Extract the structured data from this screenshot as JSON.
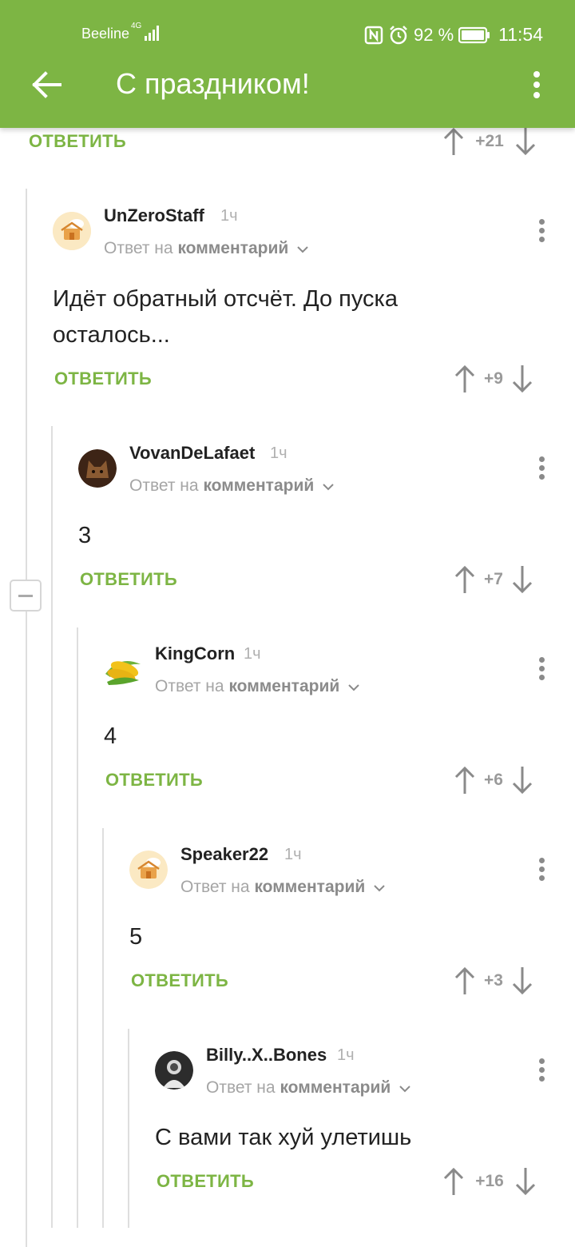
{
  "status_bar": {
    "carrier": "Beeline",
    "network": "4G",
    "battery": "92 %",
    "time": "11:54"
  },
  "header": {
    "title": "С праздником!",
    "back_icon": "arrow-left-icon",
    "menu_icon": "kebab-menu-icon"
  },
  "top_action": {
    "reply_label": "ОТВЕТИТЬ",
    "score": "+21"
  },
  "comments": [
    {
      "author": "UnZeroStaff",
      "age": "1ч",
      "reply_prefix": "Ответ на",
      "reply_link": "комментарий",
      "text_line1": "Идёт обратный отсчёт. До пуска",
      "text_line2": "осталось...",
      "reply_label": "ОТВЕТИТЬ",
      "score": "+9"
    },
    {
      "author": "VovanDeLafaet",
      "age": "1ч",
      "reply_prefix": "Ответ на",
      "reply_link": "комментарий",
      "text_line1": "3",
      "reply_label": "ОТВЕТИТЬ",
      "score": "+7"
    },
    {
      "author": "KingCorn",
      "age": "1ч",
      "reply_prefix": "Ответ на",
      "reply_link": "комментарий",
      "text_line1": "4",
      "reply_label": "ОТВЕТИТЬ",
      "score": "+6"
    },
    {
      "author": "Speaker22",
      "age": "1ч",
      "reply_prefix": "Ответ на",
      "reply_link": "комментарий",
      "text_line1": "5",
      "reply_label": "ОТВЕТИТЬ",
      "score": "+3"
    },
    {
      "author": "Billy..X..Bones",
      "age": "1ч",
      "reply_prefix": "Ответ на",
      "reply_link": "комментарий",
      "text_line1": "С вами так хуй улетишь",
      "reply_label": "ОТВЕТИТЬ",
      "score": "+16"
    }
  ],
  "colors": {
    "accent": "#7db544",
    "vote_gray": "#9a9a9a",
    "thread_line": "#dedede"
  }
}
